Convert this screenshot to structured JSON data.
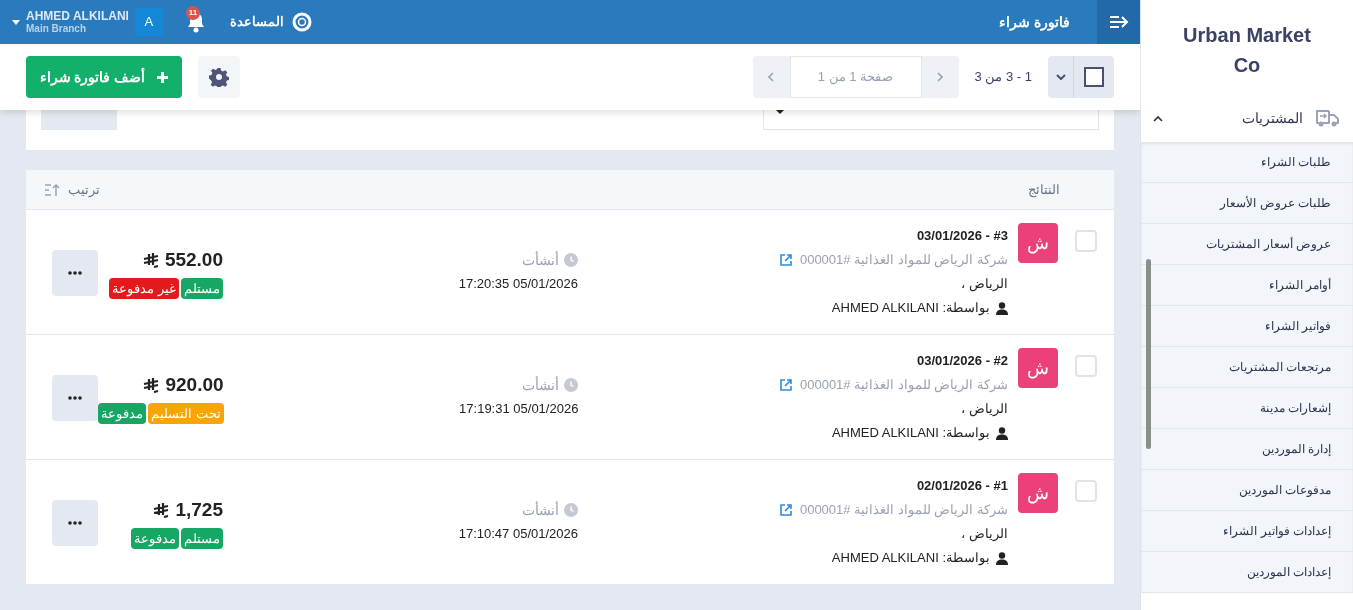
{
  "header": {
    "title": "فاتورة شراء",
    "help": "المساعدة",
    "notifications": "11",
    "user": {
      "name": "AHMED ALKILANI",
      "branch": "Main Branch",
      "initial": "A"
    }
  },
  "toolbar": {
    "select_all": {
      "checked": false
    },
    "range": "1 - 3 من 3",
    "page": "صفحة 1 من 1",
    "add_button": "أضف فاتورة شراء"
  },
  "results": {
    "title": "النتائج",
    "sort": "ترتيب",
    "rows": [
      {
        "checked": false,
        "avatar": "ش",
        "title": "#3 - 03/01/2026",
        "supplier": "شركة الرياض للمواد الغذائية #000001",
        "city": "الرياض ،",
        "by": "بواسطة: AHMED ALKILANI",
        "created_label": "أنشأت",
        "created": "05/01/2026 17:20:35",
        "amount": "552.00",
        "tags": [
          {
            "label": "مستلم",
            "color": "#16a765"
          },
          {
            "label": "غير مدفوعة",
            "color": "#e3191c"
          }
        ]
      },
      {
        "checked": false,
        "avatar": "ش",
        "title": "#2 - 03/01/2026",
        "supplier": "شركة الرياض للمواد الغذائية #000001",
        "city": "الرياض ،",
        "by": "بواسطة: AHMED ALKILANI",
        "created_label": "أنشأت",
        "created": "05/01/2026 17:19:31",
        "amount": "920.00",
        "tags": [
          {
            "label": "تحت التسليم",
            "color": "#f9a400"
          },
          {
            "label": "مدفوعة",
            "color": "#16a765"
          }
        ]
      },
      {
        "checked": false,
        "avatar": "ش",
        "title": "#1 - 02/01/2026",
        "supplier": "شركة الرياض للمواد الغذائية #000001",
        "city": "الرياض ،",
        "by": "بواسطة: AHMED ALKILANI",
        "created_label": "أنشأت",
        "created": "05/01/2026 17:10:47",
        "amount": "1,725",
        "tags": [
          {
            "label": "مستلم",
            "color": "#16a765"
          },
          {
            "label": "مدفوعة",
            "color": "#16a765"
          }
        ]
      }
    ]
  },
  "sidebar": {
    "brand": "Urban Market Co",
    "section": {
      "label": "المشتريات",
      "expanded": true,
      "items": [
        {
          "label": "طلبات الشراء"
        },
        {
          "label": "طلبات عروض الأسعار"
        },
        {
          "label": "عروض أسعار المشتريات"
        },
        {
          "label": "أوامر الشراء"
        },
        {
          "label": "فواتير الشراء"
        },
        {
          "label": "مرتجعات المشتريات"
        },
        {
          "label": "إشعارات مدينة"
        },
        {
          "label": "إدارة الموردين"
        },
        {
          "label": "مدفوعات الموردين"
        },
        {
          "label": "إعدادات فواتير الشراء"
        },
        {
          "label": "إعدادات الموردين"
        }
      ]
    }
  }
}
